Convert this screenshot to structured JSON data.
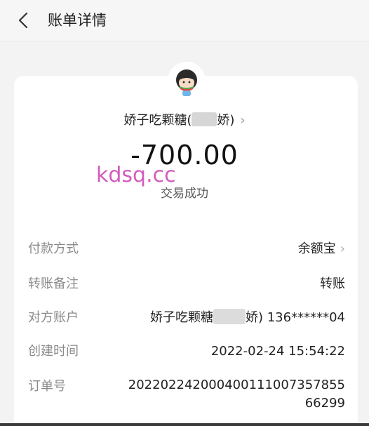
{
  "header": {
    "title": "账单详情",
    "back_icon": "chevron-left-icon"
  },
  "payee": {
    "name_prefix": "娇子吃颗糖(",
    "name_suffix": "娇)",
    "chevron": "›"
  },
  "amount": "-700.00",
  "watermark": "kdsq.cc",
  "status": "交易成功",
  "details": {
    "payment_method": {
      "label": "付款方式",
      "value": "余额宝",
      "chevron": "›"
    },
    "transfer_note": {
      "label": "转账备注",
      "value": "转账"
    },
    "counterparty": {
      "label": "对方账户",
      "value_prefix": "娇子吃颗糖",
      "value_suffix": "娇) 136******04"
    },
    "created_time": {
      "label": "创建时间",
      "value": "2022-02-24 15:54:22"
    },
    "order_no": {
      "label": "订单号",
      "value": "20220224200040011100735785566299"
    }
  },
  "colors": {
    "background": "#f3f3f3",
    "card": "#ffffff",
    "watermark": "#d35cbc",
    "label": "#8a8a8a"
  }
}
